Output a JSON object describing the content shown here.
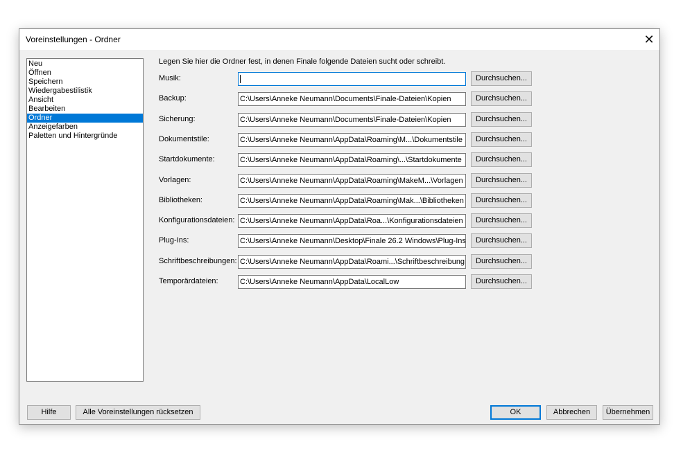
{
  "window": {
    "title": "Voreinstellungen - Ordner",
    "close_icon": "close-icon"
  },
  "categories": [
    {
      "label": "Neu",
      "selected": false
    },
    {
      "label": "Öffnen",
      "selected": false
    },
    {
      "label": "Speichern",
      "selected": false
    },
    {
      "label": "Wiedergabestilistik",
      "selected": false
    },
    {
      "label": "Ansicht",
      "selected": false
    },
    {
      "label": "Bearbeiten",
      "selected": false
    },
    {
      "label": "Ordner",
      "selected": true
    },
    {
      "label": "Anzeigefarben",
      "selected": false
    },
    {
      "label": "Paletten und Hintergründe",
      "selected": false
    }
  ],
  "intro": "Legen Sie hier die Ordner fest, in denen Finale folgende Dateien sucht oder schreibt.",
  "browse_label": "Durchsuchen...",
  "folders": [
    {
      "label": "Musik:",
      "value": ""
    },
    {
      "label": "Backup:",
      "value": "C:\\Users\\Anneke Neumann\\Documents\\Finale-Dateien\\Kopien"
    },
    {
      "label": "Sicherung:",
      "value": "C:\\Users\\Anneke Neumann\\Documents\\Finale-Dateien\\Kopien"
    },
    {
      "label": "Dokumentstile:",
      "value": "C:\\Users\\Anneke Neumann\\AppData\\Roaming\\M...\\Dokumentstile"
    },
    {
      "label": "Startdokumente:",
      "value": "C:\\Users\\Anneke Neumann\\AppData\\Roaming\\...\\Startdokumente"
    },
    {
      "label": "Vorlagen:",
      "value": "C:\\Users\\Anneke Neumann\\AppData\\Roaming\\MakeM...\\Vorlagen"
    },
    {
      "label": "Bibliotheken:",
      "value": "C:\\Users\\Anneke Neumann\\AppData\\Roaming\\Mak...\\Bibliotheken"
    },
    {
      "label": "Konfigurationsdateien:",
      "value": "C:\\Users\\Anneke Neumann\\AppData\\Roa...\\Konfigurationsdateien"
    },
    {
      "label": "Plug-Ins:",
      "value": "C:\\Users\\Anneke Neumann\\Desktop\\Finale 26.2 Windows\\Plug-Ins"
    },
    {
      "label": "Schriftbeschreibungen:",
      "value": "C:\\Users\\Anneke Neumann\\AppData\\Roami...\\Schriftbeschreibung"
    },
    {
      "label": "Temporärdateien:",
      "value": "C:\\Users\\Anneke Neumann\\AppData\\LocalLow"
    }
  ],
  "footer": {
    "help": "Hilfe",
    "reset": "Alle Voreinstellungen rücksetzen",
    "ok": "OK",
    "cancel": "Abbrechen",
    "apply": "Übernehmen"
  }
}
